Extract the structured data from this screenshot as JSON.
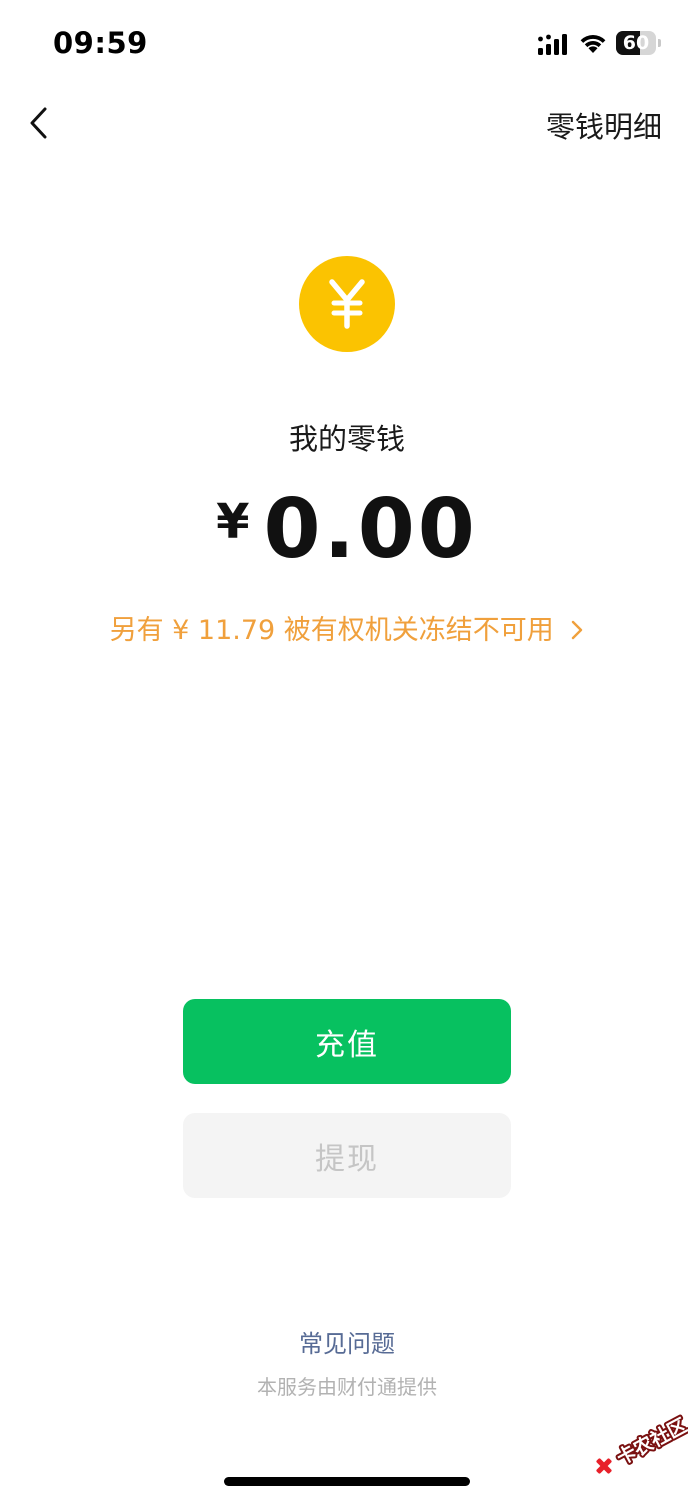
{
  "status_bar": {
    "time": "09:59",
    "battery_level": "60",
    "battery_fraction": 0.6
  },
  "nav": {
    "back_icon": "chevron-left-icon",
    "detail_label": "零钱明细"
  },
  "wallet": {
    "coin_icon": "yuan-coin-icon",
    "coin_color": "#fbc301",
    "label": "我的零钱",
    "currency_symbol": "¥",
    "amount": "0.00",
    "frozen_notice": "另有 ¥ 11.79 被有权机关冻结不可用",
    "notice_color": "#f0a03c"
  },
  "actions": {
    "recharge_label": "充值",
    "recharge_color": "#07c160",
    "withdraw_label": "提现"
  },
  "footer": {
    "faq_label": "常见问题",
    "service_note": "本服务由财付通提供"
  },
  "watermark": {
    "text": "卡农社区"
  }
}
